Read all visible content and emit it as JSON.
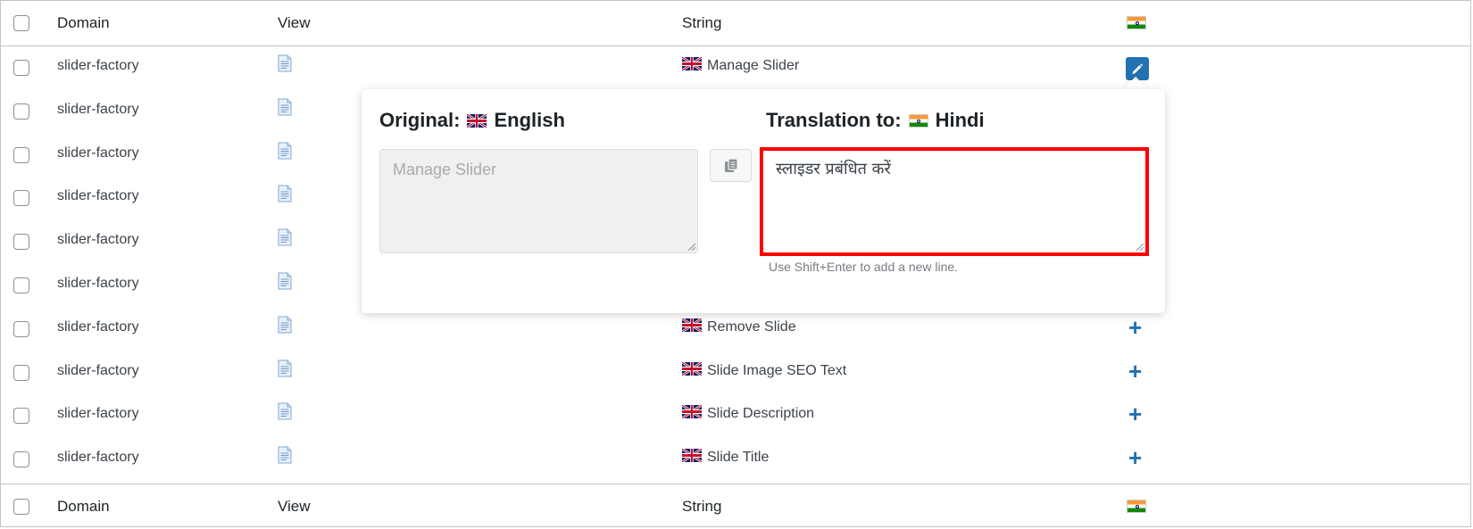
{
  "table": {
    "columns": {
      "domain": "Domain",
      "view": "View",
      "string": "String"
    },
    "rows": [
      {
        "domain": "slider-factory",
        "string": "Manage Slider",
        "action": "edit"
      },
      {
        "domain": "slider-factory",
        "string": "",
        "action": "none"
      },
      {
        "domain": "slider-factory",
        "string": "",
        "action": "none"
      },
      {
        "domain": "slider-factory",
        "string": "",
        "action": "none"
      },
      {
        "domain": "slider-factory",
        "string": "",
        "action": "none"
      },
      {
        "domain": "slider-factory",
        "string": "",
        "action": "none"
      },
      {
        "domain": "slider-factory",
        "string": "Remove Slide",
        "action": "add"
      },
      {
        "domain": "slider-factory",
        "string": "Slide Image SEO Text",
        "action": "add"
      },
      {
        "domain": "slider-factory",
        "string": "Slide Description",
        "action": "add"
      },
      {
        "domain": "slider-factory",
        "string": "Slide Title",
        "action": "add"
      }
    ]
  },
  "popup": {
    "original_label": "Original:",
    "original_language": "English",
    "translation_label": "Translation to:",
    "translation_language": "Hindi",
    "original_text": "Manage Slider",
    "translation_text": "स्लाइडर प्रबंधित करें",
    "hint": "Use Shift+Enter to add a new line."
  },
  "colors": {
    "accent": "#2271b1",
    "highlight_border": "#ff0000"
  },
  "icons": {
    "view": "document-icon",
    "copy": "copy-icon",
    "edit": "pencil-icon",
    "add": "plus-icon",
    "flag_source": "uk-flag-icon",
    "flag_target": "india-flag-icon"
  }
}
